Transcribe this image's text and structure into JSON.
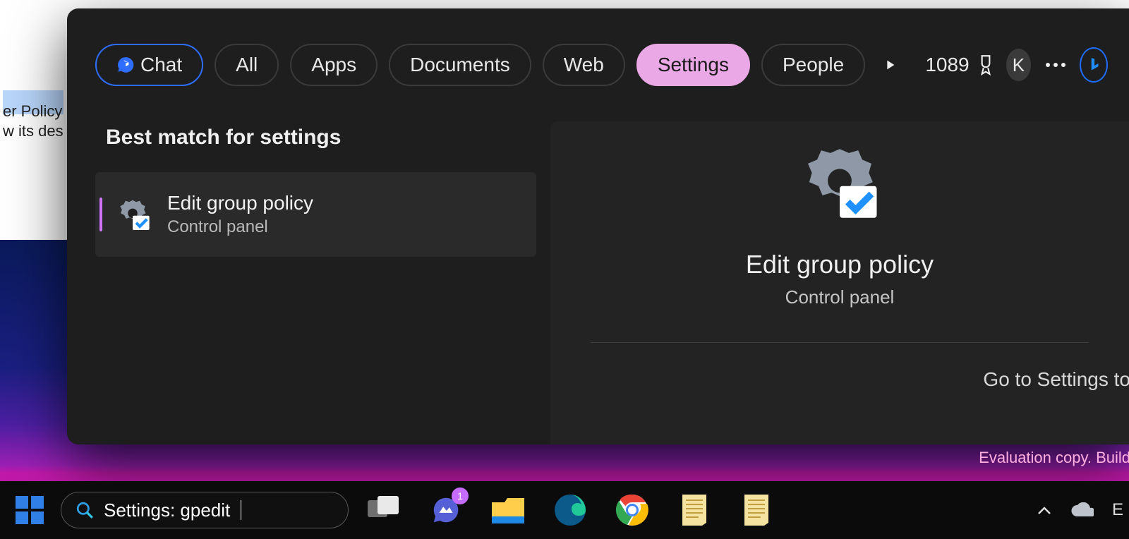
{
  "background_window": {
    "line1_partial": "er Policy",
    "line2_partial": "w its des"
  },
  "search_panel": {
    "filters": {
      "chat": "Chat",
      "all": "All",
      "apps": "Apps",
      "documents": "Documents",
      "web": "Web",
      "settings": "Settings",
      "people": "People",
      "active": "settings"
    },
    "rewards_points": "1089",
    "user_initial": "K",
    "section_heading": "Best match for settings",
    "result": {
      "title": "Edit group policy",
      "subtitle": "Control panel"
    },
    "preview": {
      "title": "Edit group policy",
      "subtitle": "Control panel",
      "action": "Go to Settings to"
    }
  },
  "watermark": "Evaluation copy. Build",
  "taskbar": {
    "search_text": "Settings: gpedit",
    "chat_badge": "1",
    "tray_extra": "E"
  }
}
